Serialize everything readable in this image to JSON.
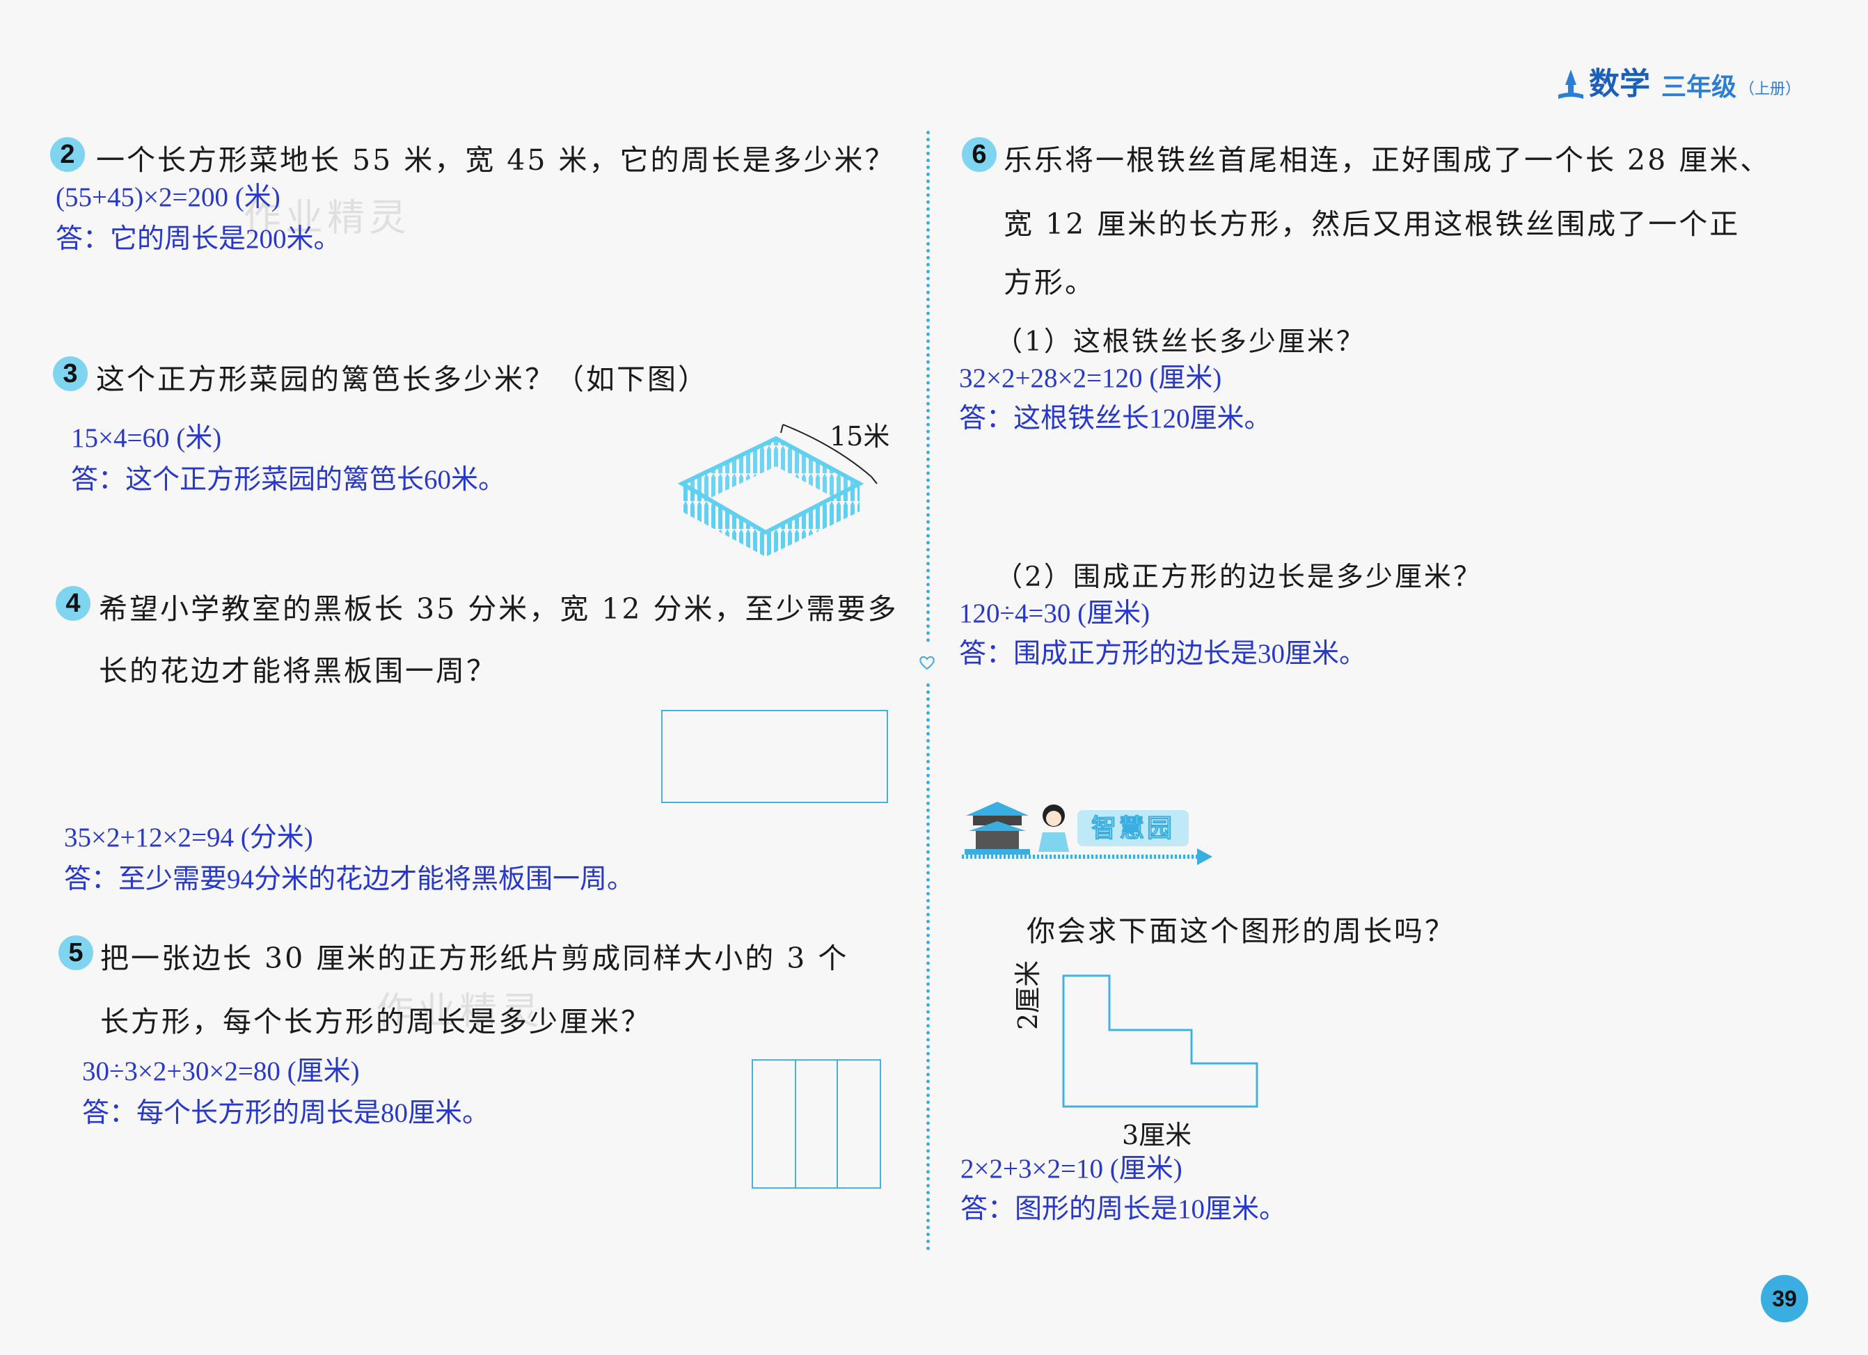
{
  "header": {
    "subject": "数学",
    "grade": "三年级",
    "volume": "（上册）"
  },
  "page_number": "39",
  "watermark": "作业精灵",
  "q2": {
    "num": "2",
    "text": "一个长方形菜地长 55 米，宽 45 米，它的周长是多少米？",
    "ans1": "(55+45)×2=200 (米)",
    "ans2": "答：它的周长是200米。"
  },
  "q3": {
    "num": "3",
    "text": "这个正方形菜园的篱笆长多少米？（如下图）",
    "ans1": "15×4=60 (米)",
    "ans2": "答：这个正方形菜园的篱笆长60米。",
    "fig_label": "15米"
  },
  "q4": {
    "num": "4",
    "text1": "希望小学教室的黑板长 35 分米，宽 12 分米，至少需要多",
    "text2": "长的花边才能将黑板围一周？",
    "ans1": "35×2+12×2=94 (分米)",
    "ans2": "答：至少需要94分米的花边才能将黑板围一周。"
  },
  "q5": {
    "num": "5",
    "text1": "把一张边长 30 厘米的正方形纸片剪成同样大小的 3 个",
    "text2": "长方形，每个长方形的周长是多少厘米？",
    "ans1": "30÷3×2+30×2=80 (厘米)",
    "ans2": "答：每个长方形的周长是80厘米。"
  },
  "q6": {
    "num": "6",
    "text1": "乐乐将一根铁丝首尾相连，正好围成了一个长 28 厘米、",
    "text2": "宽 12 厘米的长方形，然后又用这根铁丝围成了一个正",
    "text3": "方形。",
    "sub1": "（1）这根铁丝长多少厘米？",
    "sub1_ans1": "32×2+28×2=120 (厘米)",
    "sub1_ans2": "答：这根铁丝长120厘米。",
    "sub2": "（2）围成正方形的边长是多少厘米？",
    "sub2_ans1": "120÷4=30 (厘米)",
    "sub2_ans2": "答：围成正方形的边长是30厘米。"
  },
  "wisdom": {
    "banner": "智慧园",
    "question": "你会求下面这个图形的周长吗？",
    "label_left": "2厘米",
    "label_bottom": "3厘米",
    "ans1": "2×2+3×2=10 (厘米)",
    "ans2": "答：图形的周长是10厘米。"
  }
}
